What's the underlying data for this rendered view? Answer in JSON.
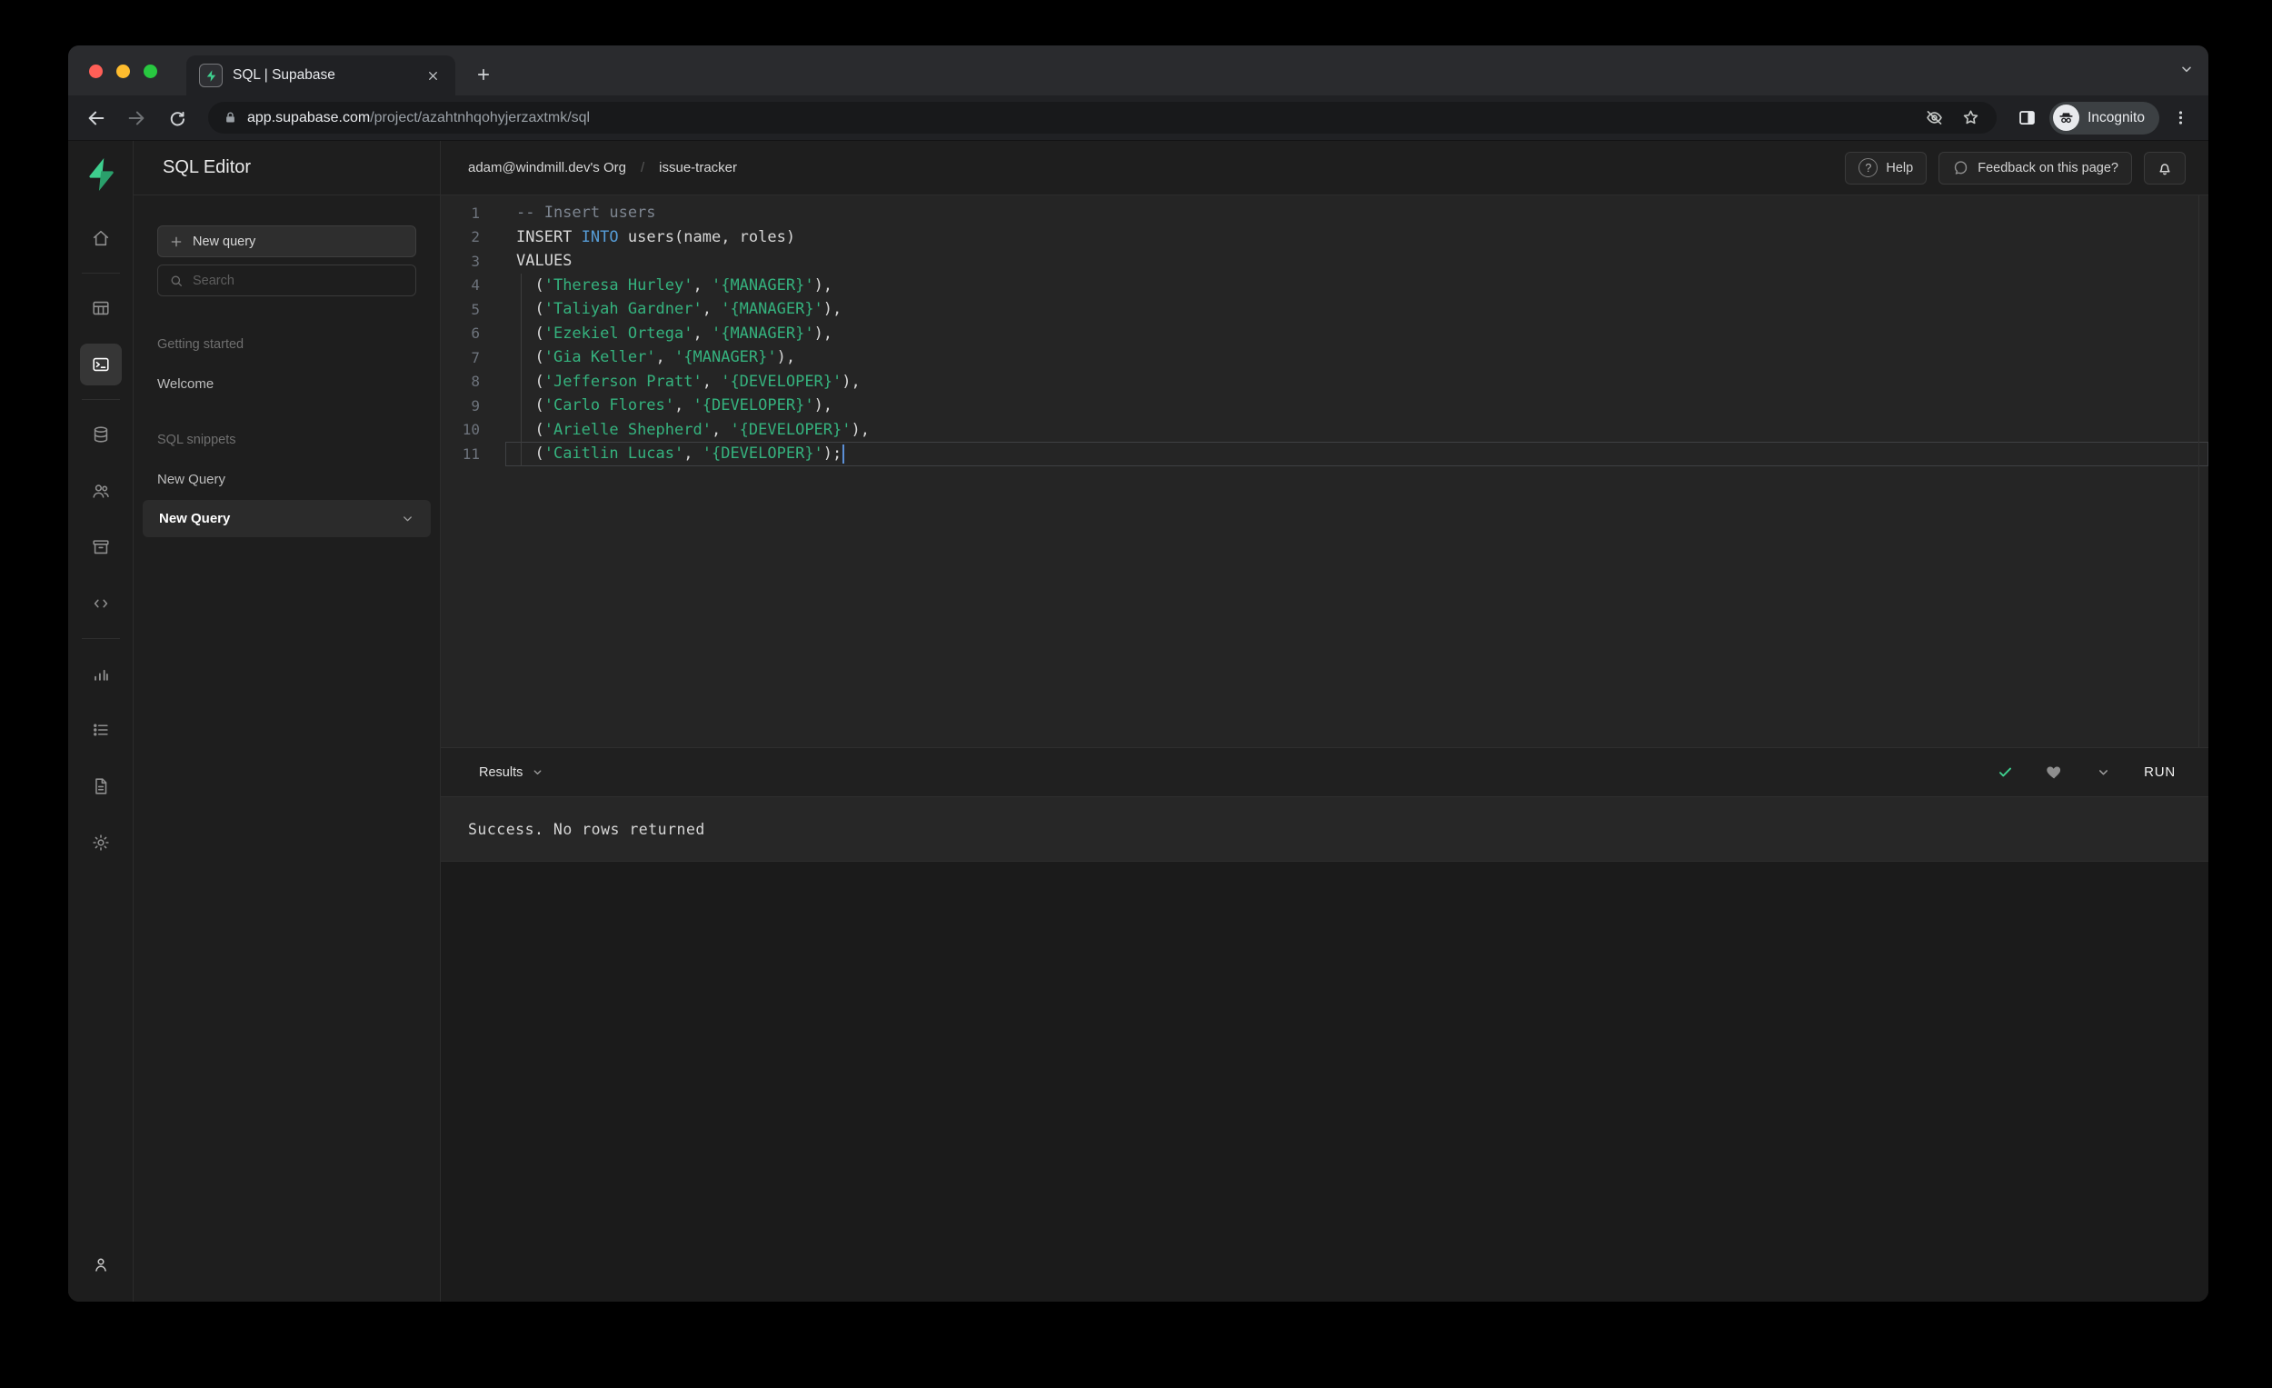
{
  "browser": {
    "tab_title": "SQL | Supabase",
    "url_domain": "app.supabase.com",
    "url_path": "/project/azahtnhqohyjerzaxtmk/sql",
    "incognito_label": "Incognito"
  },
  "rail": {
    "items": [
      {
        "id": "home",
        "icon": "home-icon"
      },
      {
        "divider": true
      },
      {
        "id": "table-editor",
        "icon": "table-editor-icon"
      },
      {
        "id": "sql-editor",
        "icon": "sql-editor-icon",
        "active": true
      },
      {
        "divider": true
      },
      {
        "id": "database",
        "icon": "database-icon"
      },
      {
        "id": "auth",
        "icon": "auth-users-icon"
      },
      {
        "id": "storage",
        "icon": "storage-icon"
      },
      {
        "id": "edge-functions",
        "icon": "code-icon"
      },
      {
        "divider": true
      },
      {
        "id": "reports",
        "icon": "reports-icon"
      },
      {
        "id": "logs",
        "icon": "logs-icon"
      },
      {
        "id": "api-docs",
        "icon": "api-docs-icon"
      },
      {
        "id": "settings",
        "icon": "settings-icon"
      }
    ],
    "bottom": {
      "id": "account",
      "icon": "user-icon"
    }
  },
  "sidebar": {
    "title": "SQL Editor",
    "new_query_button": "New query",
    "search_placeholder": "Search",
    "sections": [
      {
        "label": "Getting started",
        "items": [
          {
            "label": "Welcome",
            "selected": false
          }
        ]
      },
      {
        "label": "SQL snippets",
        "items": [
          {
            "label": "New Query",
            "selected": false
          },
          {
            "label": "New Query",
            "selected": true
          }
        ]
      }
    ]
  },
  "header": {
    "breadcrumb_org": "adam@windmill.dev's Org",
    "breadcrumb_separator": "/",
    "breadcrumb_project": "issue-tracker",
    "help_label": "Help",
    "help_icon_glyph": "?",
    "feedback_label": "Feedback on this page?"
  },
  "editor": {
    "lines": [
      {
        "n": "1",
        "segs": [
          {
            "t": "-- Insert users",
            "c": "comment"
          }
        ]
      },
      {
        "n": "2",
        "segs": [
          {
            "t": "INSERT ",
            "c": "plain"
          },
          {
            "t": "INTO",
            "c": "keyword"
          },
          {
            "t": " users(name, roles)",
            "c": "plain"
          }
        ]
      },
      {
        "n": "3",
        "segs": [
          {
            "t": "VALUES",
            "c": "plain"
          }
        ]
      },
      {
        "n": "4",
        "indent": true,
        "segs": [
          {
            "t": "  (",
            "c": "plain"
          },
          {
            "t": "'Theresa Hurley'",
            "c": "string"
          },
          {
            "t": ", ",
            "c": "plain"
          },
          {
            "t": "'{MANAGER}'",
            "c": "string"
          },
          {
            "t": "),",
            "c": "plain"
          }
        ]
      },
      {
        "n": "5",
        "indent": true,
        "segs": [
          {
            "t": "  (",
            "c": "plain"
          },
          {
            "t": "'Taliyah Gardner'",
            "c": "string"
          },
          {
            "t": ", ",
            "c": "plain"
          },
          {
            "t": "'{MANAGER}'",
            "c": "string"
          },
          {
            "t": "),",
            "c": "plain"
          }
        ]
      },
      {
        "n": "6",
        "indent": true,
        "segs": [
          {
            "t": "  (",
            "c": "plain"
          },
          {
            "t": "'Ezekiel Ortega'",
            "c": "string"
          },
          {
            "t": ", ",
            "c": "plain"
          },
          {
            "t": "'{MANAGER}'",
            "c": "string"
          },
          {
            "t": "),",
            "c": "plain"
          }
        ]
      },
      {
        "n": "7",
        "indent": true,
        "segs": [
          {
            "t": "  (",
            "c": "plain"
          },
          {
            "t": "'Gia Keller'",
            "c": "string"
          },
          {
            "t": ", ",
            "c": "plain"
          },
          {
            "t": "'{MANAGER}'",
            "c": "string"
          },
          {
            "t": "),",
            "c": "plain"
          }
        ]
      },
      {
        "n": "8",
        "indent": true,
        "segs": [
          {
            "t": "  (",
            "c": "plain"
          },
          {
            "t": "'Jefferson Pratt'",
            "c": "string"
          },
          {
            "t": ", ",
            "c": "plain"
          },
          {
            "t": "'{DEVELOPER}'",
            "c": "string"
          },
          {
            "t": "),",
            "c": "plain"
          }
        ]
      },
      {
        "n": "9",
        "indent": true,
        "segs": [
          {
            "t": "  (",
            "c": "plain"
          },
          {
            "t": "'Carlo Flores'",
            "c": "string"
          },
          {
            "t": ", ",
            "c": "plain"
          },
          {
            "t": "'{DEVELOPER}'",
            "c": "string"
          },
          {
            "t": "),",
            "c": "plain"
          }
        ]
      },
      {
        "n": "10",
        "indent": true,
        "segs": [
          {
            "t": "  (",
            "c": "plain"
          },
          {
            "t": "'Arielle Shepherd'",
            "c": "string"
          },
          {
            "t": ", ",
            "c": "plain"
          },
          {
            "t": "'{DEVELOPER}'",
            "c": "string"
          },
          {
            "t": "),",
            "c": "plain"
          }
        ]
      },
      {
        "n": "11",
        "indent": true,
        "current": true,
        "cursor": true,
        "segs": [
          {
            "t": "  (",
            "c": "plain"
          },
          {
            "t": "'Caitlin Lucas'",
            "c": "string"
          },
          {
            "t": ", ",
            "c": "plain"
          },
          {
            "t": "'{DEVELOPER}'",
            "c": "string"
          },
          {
            "t": ");",
            "c": "plain"
          }
        ]
      }
    ]
  },
  "results": {
    "tab_label": "Results",
    "run_label": "RUN",
    "success_message": "Success. No rows returned"
  },
  "colors": {
    "accent_green": "#3ECF8E",
    "keyword_blue": "#569CD6",
    "string_green": "#35B27E",
    "cursor_blue": "#5B8FD6"
  }
}
